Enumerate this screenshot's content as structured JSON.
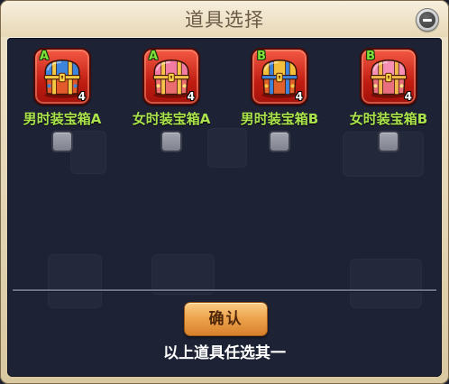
{
  "dialog": {
    "title": "道具选择",
    "confirm_label": "确认",
    "hint": "以上道具任选其一",
    "close_icon": "minus-icon"
  },
  "items": [
    {
      "badge": "A",
      "count": 4,
      "label": "男时装宝箱A",
      "icon": "treasure-chest-icon",
      "selected": false,
      "palette": {
        "lid": "#3d84dc",
        "trim": "#f6c945",
        "body": "#e35a2b",
        "accent": "#3d84dc"
      }
    },
    {
      "badge": "A",
      "count": 4,
      "label": "女时装宝箱A",
      "icon": "treasure-chest-icon",
      "selected": false,
      "palette": {
        "lid": "#f27ba3",
        "trim": "#f6c24a",
        "body": "#ea6d6f",
        "accent": "#ffe07a"
      }
    },
    {
      "badge": "B",
      "count": 4,
      "label": "男时装宝箱B",
      "icon": "treasure-chest-icon",
      "selected": false,
      "palette": {
        "lid": "#f4bf3a",
        "trim": "#3d84dc",
        "body": "#e0612a",
        "accent": "#f6c945"
      }
    },
    {
      "badge": "B",
      "count": 4,
      "label": "女时装宝箱B",
      "icon": "treasure-chest-icon",
      "selected": false,
      "palette": {
        "lid": "#f58fb5",
        "trim": "#f3b64a",
        "body": "#e8707e",
        "accent": "#fbe28a"
      }
    }
  ],
  "colors": {
    "title_text": "#6b5a47",
    "panel_bg": "#1d2235",
    "item_label": "#a9e24c",
    "badge_text": "#7ee23c",
    "hint_text": "#ffffff",
    "tile_red": "#c01d12",
    "button_orange": "#eea54e"
  }
}
